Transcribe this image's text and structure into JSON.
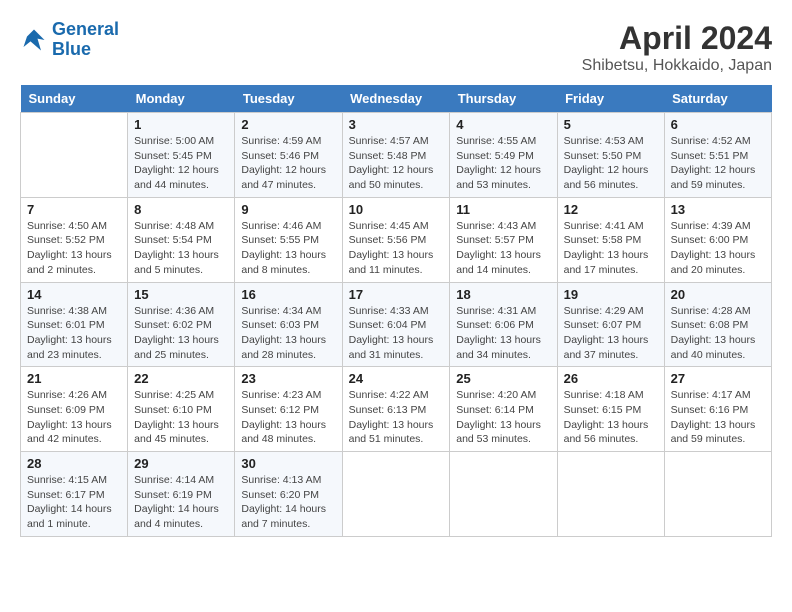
{
  "logo": {
    "line1": "General",
    "line2": "Blue"
  },
  "title": "April 2024",
  "location": "Shibetsu, Hokkaido, Japan",
  "days_of_week": [
    "Sunday",
    "Monday",
    "Tuesday",
    "Wednesday",
    "Thursday",
    "Friday",
    "Saturday"
  ],
  "weeks": [
    [
      {
        "day": "",
        "info": ""
      },
      {
        "day": "1",
        "info": "Sunrise: 5:00 AM\nSunset: 5:45 PM\nDaylight: 12 hours\nand 44 minutes."
      },
      {
        "day": "2",
        "info": "Sunrise: 4:59 AM\nSunset: 5:46 PM\nDaylight: 12 hours\nand 47 minutes."
      },
      {
        "day": "3",
        "info": "Sunrise: 4:57 AM\nSunset: 5:48 PM\nDaylight: 12 hours\nand 50 minutes."
      },
      {
        "day": "4",
        "info": "Sunrise: 4:55 AM\nSunset: 5:49 PM\nDaylight: 12 hours\nand 53 minutes."
      },
      {
        "day": "5",
        "info": "Sunrise: 4:53 AM\nSunset: 5:50 PM\nDaylight: 12 hours\nand 56 minutes."
      },
      {
        "day": "6",
        "info": "Sunrise: 4:52 AM\nSunset: 5:51 PM\nDaylight: 12 hours\nand 59 minutes."
      }
    ],
    [
      {
        "day": "7",
        "info": "Sunrise: 4:50 AM\nSunset: 5:52 PM\nDaylight: 13 hours\nand 2 minutes."
      },
      {
        "day": "8",
        "info": "Sunrise: 4:48 AM\nSunset: 5:54 PM\nDaylight: 13 hours\nand 5 minutes."
      },
      {
        "day": "9",
        "info": "Sunrise: 4:46 AM\nSunset: 5:55 PM\nDaylight: 13 hours\nand 8 minutes."
      },
      {
        "day": "10",
        "info": "Sunrise: 4:45 AM\nSunset: 5:56 PM\nDaylight: 13 hours\nand 11 minutes."
      },
      {
        "day": "11",
        "info": "Sunrise: 4:43 AM\nSunset: 5:57 PM\nDaylight: 13 hours\nand 14 minutes."
      },
      {
        "day": "12",
        "info": "Sunrise: 4:41 AM\nSunset: 5:58 PM\nDaylight: 13 hours\nand 17 minutes."
      },
      {
        "day": "13",
        "info": "Sunrise: 4:39 AM\nSunset: 6:00 PM\nDaylight: 13 hours\nand 20 minutes."
      }
    ],
    [
      {
        "day": "14",
        "info": "Sunrise: 4:38 AM\nSunset: 6:01 PM\nDaylight: 13 hours\nand 23 minutes."
      },
      {
        "day": "15",
        "info": "Sunrise: 4:36 AM\nSunset: 6:02 PM\nDaylight: 13 hours\nand 25 minutes."
      },
      {
        "day": "16",
        "info": "Sunrise: 4:34 AM\nSunset: 6:03 PM\nDaylight: 13 hours\nand 28 minutes."
      },
      {
        "day": "17",
        "info": "Sunrise: 4:33 AM\nSunset: 6:04 PM\nDaylight: 13 hours\nand 31 minutes."
      },
      {
        "day": "18",
        "info": "Sunrise: 4:31 AM\nSunset: 6:06 PM\nDaylight: 13 hours\nand 34 minutes."
      },
      {
        "day": "19",
        "info": "Sunrise: 4:29 AM\nSunset: 6:07 PM\nDaylight: 13 hours\nand 37 minutes."
      },
      {
        "day": "20",
        "info": "Sunrise: 4:28 AM\nSunset: 6:08 PM\nDaylight: 13 hours\nand 40 minutes."
      }
    ],
    [
      {
        "day": "21",
        "info": "Sunrise: 4:26 AM\nSunset: 6:09 PM\nDaylight: 13 hours\nand 42 minutes."
      },
      {
        "day": "22",
        "info": "Sunrise: 4:25 AM\nSunset: 6:10 PM\nDaylight: 13 hours\nand 45 minutes."
      },
      {
        "day": "23",
        "info": "Sunrise: 4:23 AM\nSunset: 6:12 PM\nDaylight: 13 hours\nand 48 minutes."
      },
      {
        "day": "24",
        "info": "Sunrise: 4:22 AM\nSunset: 6:13 PM\nDaylight: 13 hours\nand 51 minutes."
      },
      {
        "day": "25",
        "info": "Sunrise: 4:20 AM\nSunset: 6:14 PM\nDaylight: 13 hours\nand 53 minutes."
      },
      {
        "day": "26",
        "info": "Sunrise: 4:18 AM\nSunset: 6:15 PM\nDaylight: 13 hours\nand 56 minutes."
      },
      {
        "day": "27",
        "info": "Sunrise: 4:17 AM\nSunset: 6:16 PM\nDaylight: 13 hours\nand 59 minutes."
      }
    ],
    [
      {
        "day": "28",
        "info": "Sunrise: 4:15 AM\nSunset: 6:17 PM\nDaylight: 14 hours\nand 1 minute."
      },
      {
        "day": "29",
        "info": "Sunrise: 4:14 AM\nSunset: 6:19 PM\nDaylight: 14 hours\nand 4 minutes."
      },
      {
        "day": "30",
        "info": "Sunrise: 4:13 AM\nSunset: 6:20 PM\nDaylight: 14 hours\nand 7 minutes."
      },
      {
        "day": "",
        "info": ""
      },
      {
        "day": "",
        "info": ""
      },
      {
        "day": "",
        "info": ""
      },
      {
        "day": "",
        "info": ""
      }
    ]
  ]
}
